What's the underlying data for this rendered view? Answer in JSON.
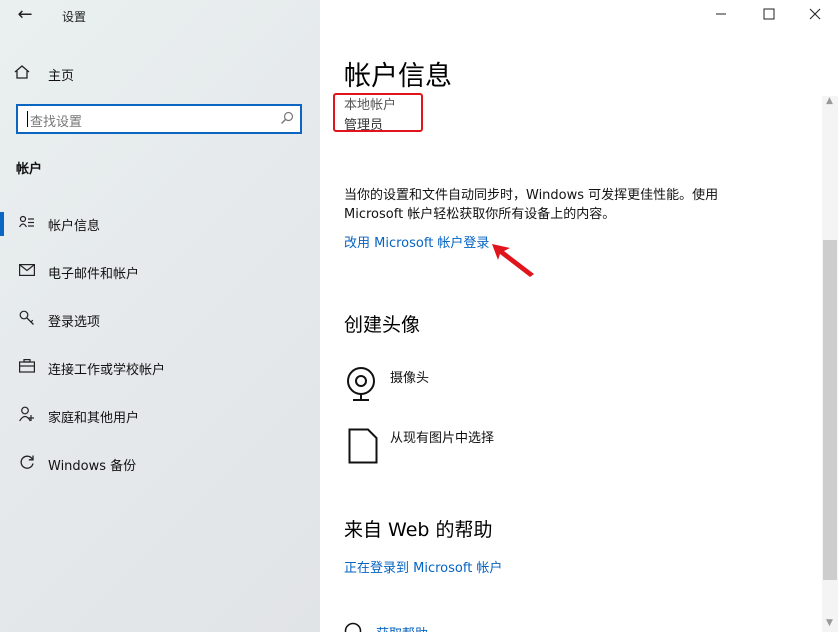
{
  "window": {
    "app_title": "设置",
    "controls": {
      "minimize": "—",
      "maximize": "☐",
      "close": "✕"
    }
  },
  "sidebar": {
    "home_label": "主页",
    "search_placeholder": "查找设置",
    "section": "帐户",
    "items": [
      {
        "label": "帐户信息",
        "icon": "account-info-icon",
        "selected": true
      },
      {
        "label": "电子邮件和帐户",
        "icon": "email-icon",
        "selected": false
      },
      {
        "label": "登录选项",
        "icon": "key-icon",
        "selected": false
      },
      {
        "label": "连接工作或学校帐户",
        "icon": "briefcase-icon",
        "selected": false
      },
      {
        "label": "家庭和其他用户",
        "icon": "person-add-icon",
        "selected": false
      },
      {
        "label": "Windows 备份",
        "icon": "sync-icon",
        "selected": false
      }
    ]
  },
  "main": {
    "title": "帐户信息",
    "account_type": "本地帐户",
    "account_role": "管理员",
    "description_line1": "当你的设置和文件自动同步时，Windows 可发挥更佳性能。使用",
    "description_line2": "Microsoft 帐户轻松获取你所有设备上的内容。",
    "ms_login_link": "改用 Microsoft 帐户登录",
    "avatar_section": "创建头像",
    "camera_label": "摄像头",
    "browse_label": "从现有图片中选择",
    "help_section": "来自 Web 的帮助",
    "help_link": "正在登录到 Microsoft 帐户",
    "partial_help": "获取帮助"
  },
  "colors": {
    "accent": "#0a66c2",
    "link": "#0563c1",
    "highlight_box": "#e0151c"
  }
}
